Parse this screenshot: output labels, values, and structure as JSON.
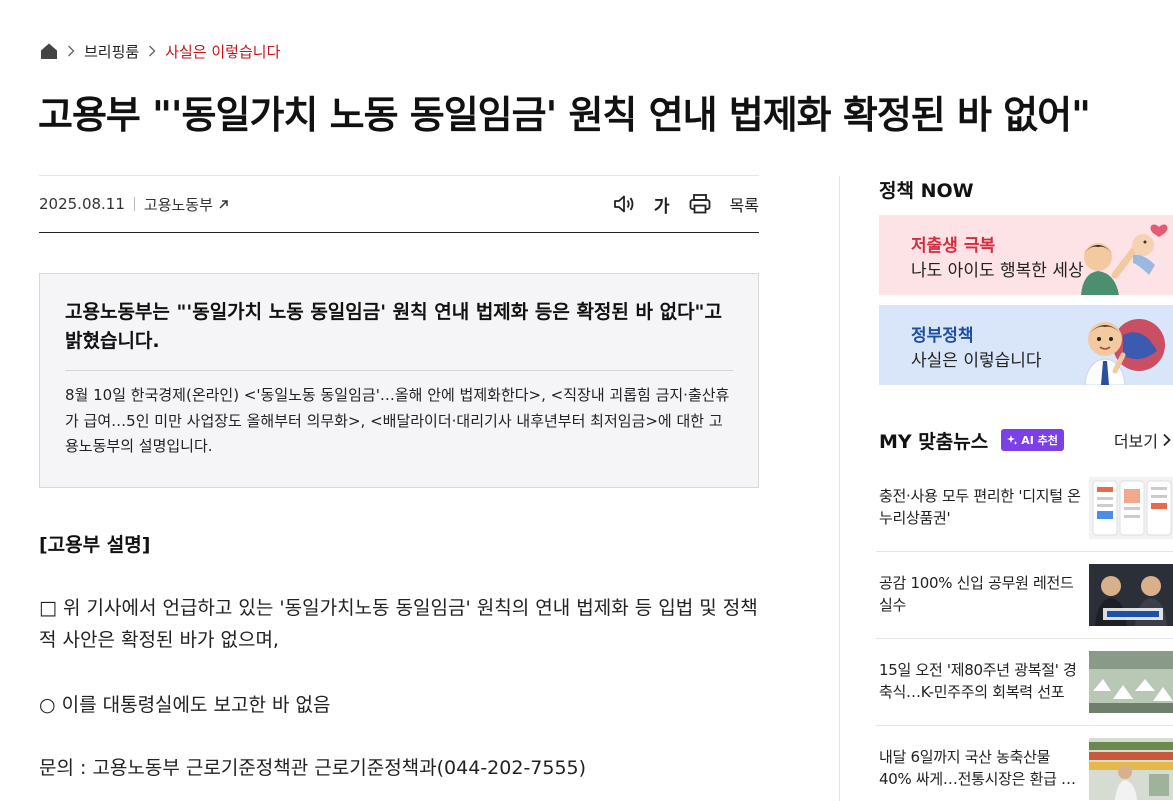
{
  "breadcrumb": {
    "home_icon": "home-icon",
    "items": [
      "브리핑룸",
      "사실은 이렇습니다"
    ]
  },
  "headline": "고용부 \"'동일가치 노동 동일임금' 원칙 연내 법제화 확정된 바 없어\"",
  "meta": {
    "date": "2025.08.11",
    "agency": "고용노동부",
    "tools": {
      "speaker_icon": "speaker-icon",
      "font_label": "가",
      "print_icon": "print-icon",
      "list_label": "목록"
    }
  },
  "summary": {
    "lead": "고용노동부는 \"'동일가치 노동 동일임금' 원칙 연내 법제화 등은 확정된 바 없다\"고 밝혔습니다.",
    "body": "8월 10일 한국경제(온라인) <'동일노동 동일임금'…올해 안에 법제화한다>, <직장내 괴롭힘 금지·출산휴가 급여…5인 미만 사업장도 올해부터 의무화>, <배달라이더·대리기사 내후년부터 최저임금>에 대한 고용노동부의 설명입니다."
  },
  "article": {
    "heading": "[고용부 설명]",
    "p1": "□ 위 기사에서 언급하고 있는 '동일가치노동 동일임금' 원칙의 연내 법제화 등 입법 및 정책적 사안은 확정된 바가 없으며,",
    "p2": "○ 이를 대통령실에도 보고한 바 없음",
    "p3": "문의 : 고용노동부 근로기준정책관 근로기준정책과(044-202-7555)"
  },
  "sidebar": {
    "title": "정책 NOW",
    "banners": [
      {
        "title": "저출생 극복",
        "subtitle": "나도 아이도 행복한 세상",
        "accent": "#d42c3f",
        "bg": "#fde3e5"
      },
      {
        "title": "정부정책",
        "subtitle": "사실은 이렇습니다",
        "accent": "#1d4fa6",
        "bg": "#d9e5f8"
      }
    ],
    "mynews": {
      "title": "MY 맞춤뉴스",
      "ai_badge": "AI 추천",
      "more_label": "더보기",
      "items": [
        {
          "text": "충전·사용 모두 편리한 '디지털 온누리상품권'"
        },
        {
          "text": "공감 100% 신입 공무원 레전드 실수"
        },
        {
          "text": "15일 오전 '제80주년 광복절' 경축식…K-민주주의 회복력 선포"
        },
        {
          "text": "내달 6일까지 국산 농축산물 40% 싸게…전통시장은 환급 …"
        }
      ]
    }
  },
  "colors": {
    "accent_red": "#c4161c",
    "ai_badge": "#7d3fe6"
  }
}
